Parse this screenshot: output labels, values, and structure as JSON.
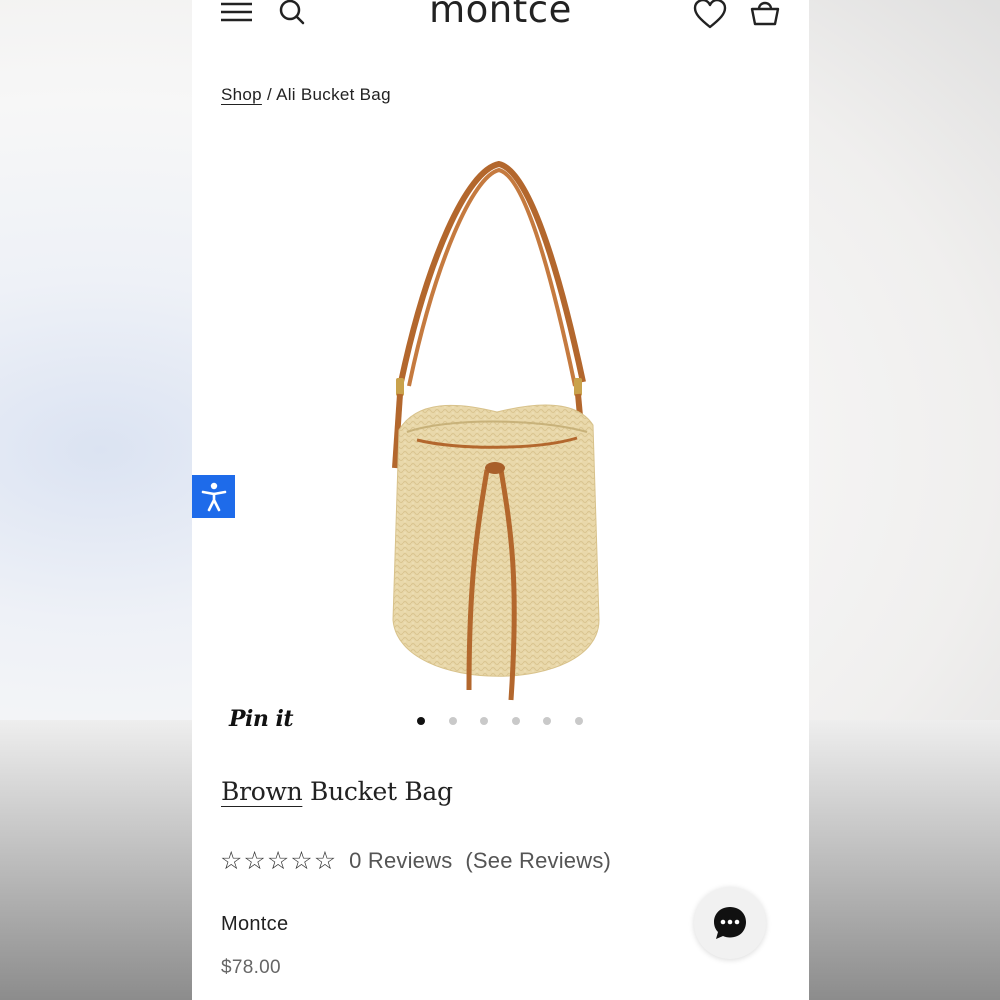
{
  "header": {
    "logo": "montce",
    "icons": [
      "menu-icon",
      "search-icon",
      "heart-icon",
      "cart-icon"
    ]
  },
  "breadcrumb": {
    "link": "Shop",
    "separator": "/",
    "current": "Ali Bucket Bag"
  },
  "product": {
    "image_alt": "Ali Bucket Bag",
    "pin_label": "Pin it",
    "gallery": {
      "count": 6,
      "active": 1
    },
    "title_prefix": "Brown",
    "title_rest": "Bucket Bag",
    "rating": {
      "stars_filled": 0,
      "stars_total": 5
    },
    "reviews_label": "0 Reviews",
    "see_reviews_label": "(See Reviews)",
    "brand": "Montce",
    "price": "$78.00"
  },
  "colors": {
    "accessibility_blue": "#1e6bea",
    "leather_brown": "#b3672d",
    "straw": "#e7d4a4"
  }
}
